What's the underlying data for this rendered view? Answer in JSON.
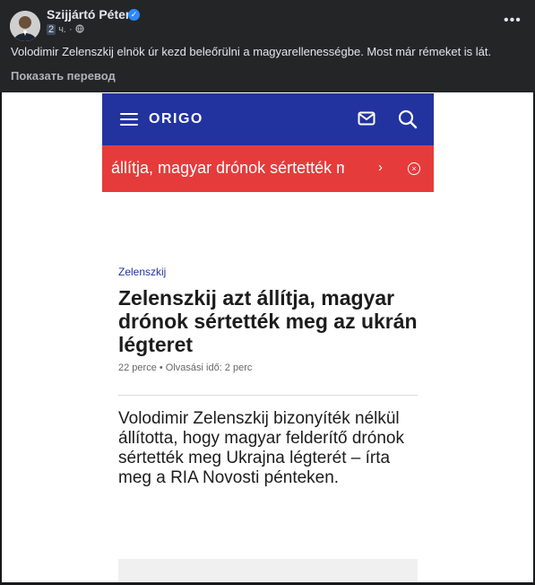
{
  "post": {
    "author": "Szijjártó Péter",
    "time_num": "2",
    "time_unit": "ч.",
    "text": "Volodimir Zelenszkij elnök úr kezd beleőrülni a magyarellenességbe. Most már rémeket is lát.",
    "translate_label": "Показать перевод",
    "more_label": "•••",
    "verified_glyph": "✓"
  },
  "article": {
    "logo": "ORIGO",
    "ticker": "Zelenszkij azt állítja, magyar drónok sértették meg az ukrán légteret",
    "ticker_arrow": "›",
    "close_glyph": "×",
    "category": "Zelenszkij",
    "headline": "Zelenszkij azt állítja, magyar drónok sértették meg az ukrán légteret",
    "meta": "22 perce  •  Olvasási idő: 2 perc",
    "lead": "Volodimir Zelenszkij bizonyíték nélkül állította, hogy magyar felderítő drónok sértették meg Ukrajna légterét – írta meg a RIA Novosti pénteken."
  },
  "colors": {
    "origo_blue": "#2233a0",
    "ticker_red": "#e63b3b",
    "fb_bg": "#242526"
  }
}
